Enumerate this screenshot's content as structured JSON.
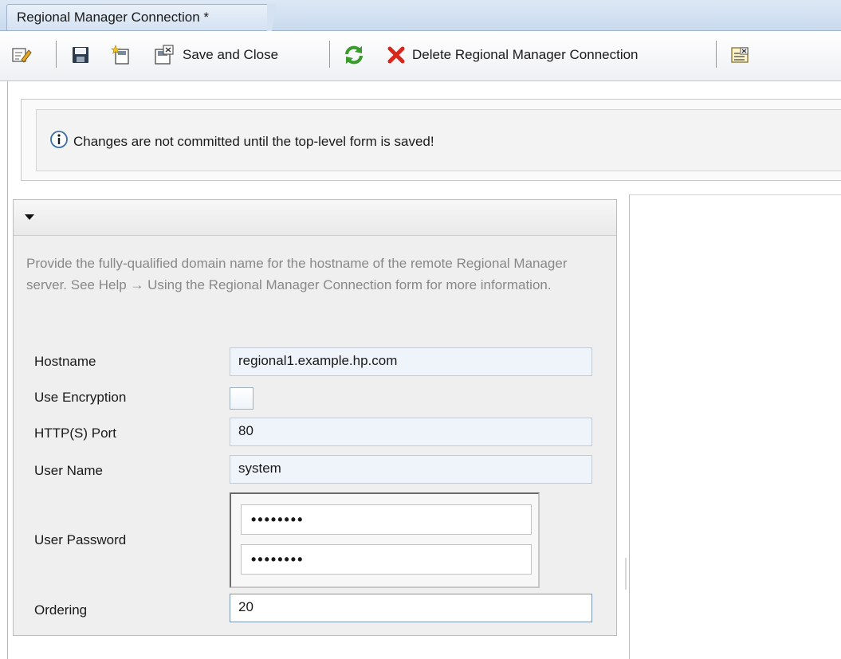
{
  "window": {
    "tab_title": "Regional Manager Connection *"
  },
  "toolbar": {
    "edit_icon": "edit-form-icon",
    "save_icon": "save-icon",
    "new_icon": "new-icon",
    "save_close_label": "Save and Close",
    "refresh_icon": "refresh-icon",
    "delete_label": "Delete Regional Manager Connection",
    "close_icon": "close-form-icon"
  },
  "banner": {
    "message": "Changes are not committed until the top-level form is saved!"
  },
  "form": {
    "description": "Provide the fully-qualified domain name for the hostname of the remote Regional Manager server. See Help → Using the Regional Manager Connection form for more information.",
    "fields": {
      "hostname": {
        "label": "Hostname",
        "value": "regional1.example.hp.com"
      },
      "use_encryption": {
        "label": "Use Encryption",
        "checked": false
      },
      "port": {
        "label": "HTTP(S) Port",
        "value": "80"
      },
      "user_name": {
        "label": "User Name",
        "value": "system"
      },
      "user_password": {
        "label": "User Password",
        "value": "••••••••",
        "confirm": "••••••••"
      },
      "ordering": {
        "label": "Ordering",
        "value": "20"
      }
    }
  },
  "colors": {
    "accent_blue": "#3a6ea5",
    "delete_red": "#d9261c",
    "refresh_green": "#3a9a2a"
  }
}
